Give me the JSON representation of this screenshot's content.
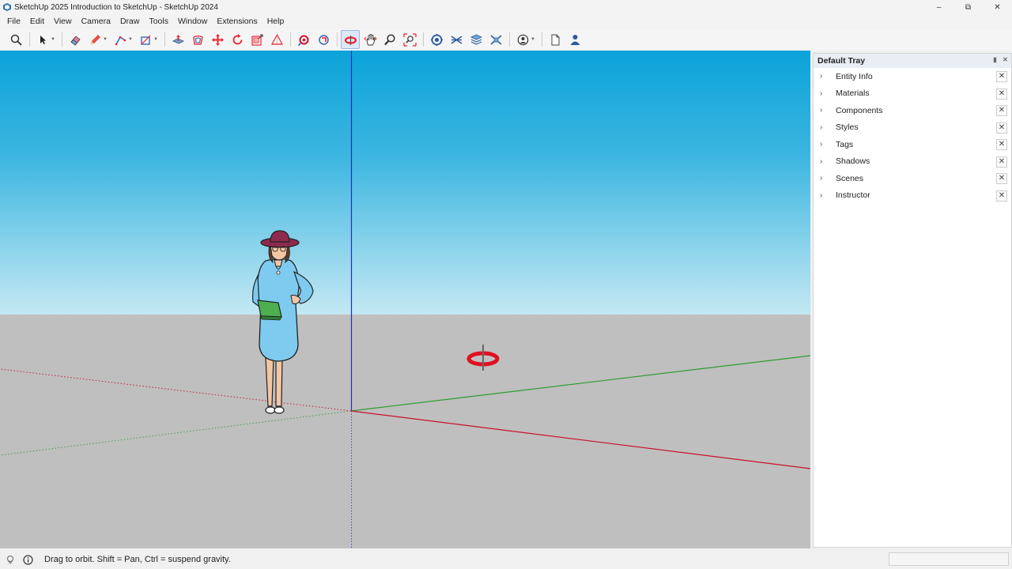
{
  "window": {
    "title": "SketchUp 2025 Introduction to SketchUp - SketchUp 2024",
    "controls": [
      "minimize",
      "restore",
      "close"
    ]
  },
  "menu": [
    "File",
    "Edit",
    "View",
    "Camera",
    "Draw",
    "Tools",
    "Window",
    "Extensions",
    "Help"
  ],
  "toolbar": {
    "tools": [
      "search-icon",
      "select-icon",
      "eraser-icon",
      "pencil-icon",
      "line-icon",
      "rectangle-icon",
      "push-pull-icon",
      "offset-icon",
      "move-icon",
      "rotate-icon",
      "scale-icon",
      "tape-measure-icon",
      "paint-bucket-icon",
      "follow-me-icon",
      "orbit-icon",
      "pan-icon",
      "zoom-icon",
      "zoom-extents-icon",
      "solid-tools-icon",
      "sandbox-icon",
      "layers-icon",
      "view-icon",
      "warehouse-icon",
      "new-icon",
      "profile-icon"
    ],
    "active_tool": "orbit-icon"
  },
  "tray": {
    "title": "Default Tray",
    "panels": [
      "Entity Info",
      "Materials",
      "Components",
      "Styles",
      "Tags",
      "Shadows",
      "Scenes",
      "Instructor"
    ]
  },
  "status": {
    "message": "Drag to orbit. Shift = Pan, Ctrl = suspend gravity."
  },
  "colors": {
    "sky_top": "#0ba3da",
    "sky_bottom": "#c3e8f2",
    "ground": "#bfbfbf",
    "red_axis": "#c8102e",
    "green_axis": "#2e9b2e",
    "blue_axis": "#1f2fbf"
  }
}
